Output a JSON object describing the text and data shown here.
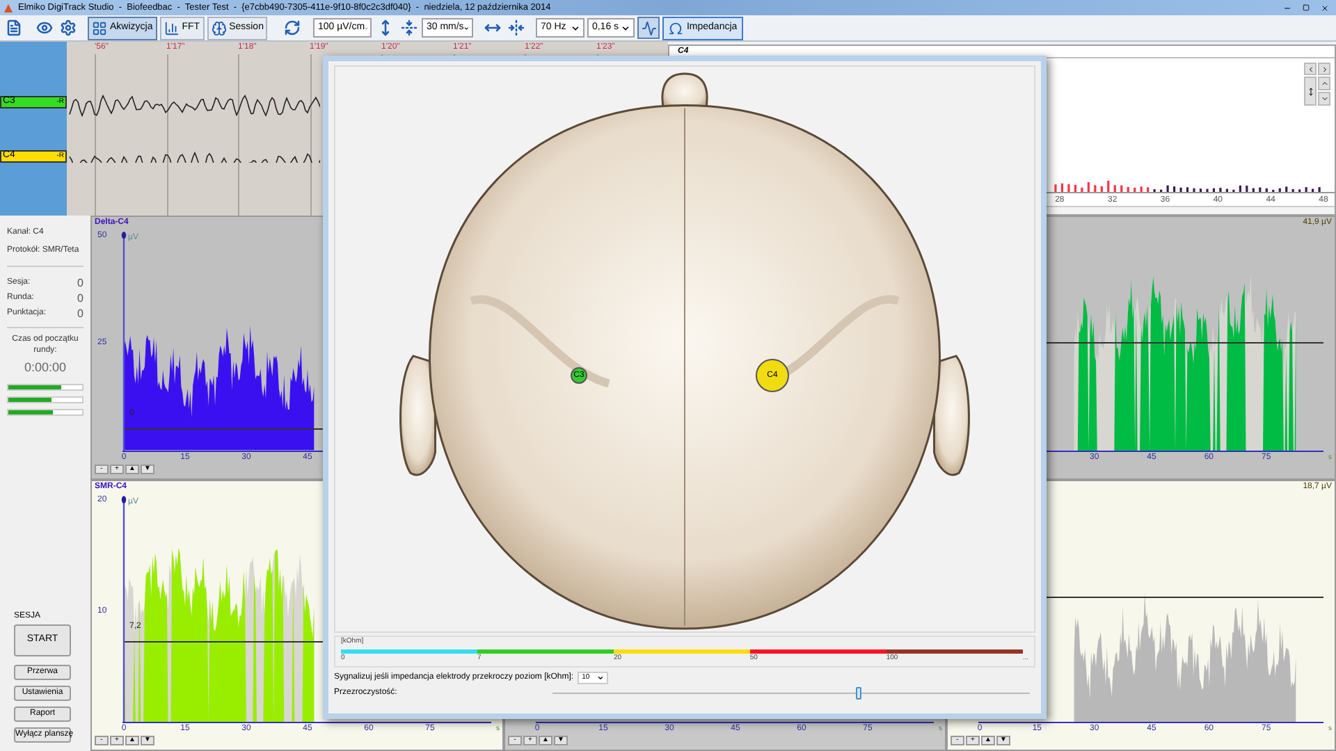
{
  "window": {
    "title": "Elmiko DigiTrack Studio  -  Biofeedbac  -  Tester Test  -  {e7cbb490-7305-411e-9f10-8f0c2c3df040}  -  niedziela, 12 października 2014"
  },
  "toolbar": {
    "modes": [
      {
        "label": "Akwizycja",
        "selected": true
      },
      {
        "label": "FFT",
        "selected": false
      },
      {
        "label": "Session",
        "selected": false
      }
    ],
    "amplitude": "100 µV/cm",
    "speed": "30 mm/s",
    "filter": "70 Hz",
    "time_constant": "0,16 s",
    "toggle": {
      "on": true
    },
    "impedance": {
      "label": "Impedancja",
      "selected": true
    }
  },
  "eeg": {
    "time_marks": [
      "'56\"",
      "1'17\"",
      "1'18\"",
      "1'19\"",
      "1'20\"",
      "1'21\"",
      "1'22\"",
      "1'23\""
    ],
    "channels": [
      {
        "label": "C3",
        "ref": "-R",
        "color": "#33dd22"
      },
      {
        "label": "C4",
        "ref": "-R",
        "color": "#ffdd00"
      }
    ]
  },
  "spectrum": {
    "title": "C4",
    "xticks": [
      "28",
      "32",
      "36",
      "40",
      "44",
      "48"
    ]
  },
  "info": {
    "channel": "Kanał: C4",
    "protocol": "Protokół: SMR/Teta",
    "counters": [
      {
        "label": "Sesja:",
        "value": "0"
      },
      {
        "label": "Runda:",
        "value": "0"
      },
      {
        "label": "Punktacja:",
        "value": "0"
      }
    ],
    "timer_label": "Czas od początku rundy:",
    "timer": "0:00:00",
    "meters": [
      {
        "level": 0.72
      },
      {
        "level": 0.58
      },
      {
        "level": 0.6
      }
    ]
  },
  "session": {
    "title": "SESJA",
    "buttons": [
      {
        "label": "START",
        "kind": "primary"
      },
      {
        "label": "Przerwa",
        "kind": "normal"
      },
      {
        "label": "Ustawienia",
        "kind": "normal"
      },
      {
        "label": "Raport",
        "kind": "normal"
      },
      {
        "label": "Wyłącz planszę",
        "kind": "normal"
      }
    ]
  },
  "charts": [
    {
      "title": "Delta-C4",
      "unit": "µV",
      "kind": "inhibit",
      "color": "#3a10f0",
      "yticks": [
        "50",
        "25"
      ],
      "threshold": {
        "label": "0"
      },
      "xticks": [
        "0",
        "15",
        "30",
        "45"
      ],
      "buttons": [
        "-",
        "+",
        "▲",
        "▼"
      ]
    },
    {
      "readout": "41,9 µV",
      "kind": "reward",
      "color": "#00bb44",
      "xticks": [
        "30",
        "45",
        "60",
        "75"
      ],
      "xunit": "s"
    },
    {
      "title": "SMR-C4",
      "unit": "µV",
      "kind": "reward",
      "color": "#99ee00",
      "yticks": [
        "20",
        "10"
      ],
      "threshold": {
        "label": "7,2"
      },
      "xticks": [
        "0",
        "15",
        "30",
        "45",
        "60",
        "75"
      ],
      "xunit": "s",
      "buttons": [
        "-",
        "+",
        "▲",
        "▼"
      ]
    },
    {
      "xticks": [
        "0",
        "15",
        "30",
        "45",
        "60",
        "75"
      ],
      "xunit": "s",
      "buttons": [
        "-",
        "+",
        "▲",
        "▼"
      ]
    },
    {
      "readout": "18,7 µV",
      "kind": "raw",
      "color": "#b8b8b8",
      "xticks": [
        "0",
        "15",
        "30",
        "45",
        "60",
        "75"
      ],
      "xunit": "s",
      "buttons": [
        "-",
        "+",
        "▲",
        "▼"
      ]
    }
  ],
  "impedance": {
    "electrodes": [
      {
        "label": "C3",
        "color": "#33cc33",
        "kind": "small"
      },
      {
        "label": "C4",
        "color": "#f0dc10",
        "kind": "large"
      }
    ],
    "scale": {
      "unit": "[kOhm]",
      "segments": [
        {
          "label": "0",
          "color": "#33ddf0"
        },
        {
          "label": "7",
          "color": "#33cc22"
        },
        {
          "label": "20",
          "color": "#ffdd00"
        },
        {
          "label": "50",
          "color": "#ff1122"
        },
        {
          "label": "100",
          "color": "#993322"
        }
      ],
      "end_label": "..."
    },
    "alarm": {
      "label": "Sygnalizuj jeśli impedancja elektrody przekroczy poziom [kOhm]:",
      "value": "10"
    },
    "opacity": {
      "label": "Przezroczystość:",
      "level": 0.64
    }
  }
}
